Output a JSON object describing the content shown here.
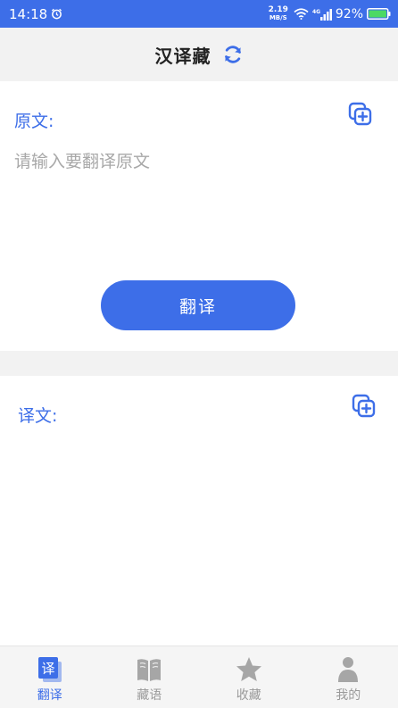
{
  "status_bar": {
    "time": "14:18",
    "net_speed_value": "2.19",
    "net_speed_unit": "MB/S",
    "network_type": "4G",
    "battery_percent": "92%"
  },
  "header": {
    "title": "汉译藏"
  },
  "source": {
    "label": "原文:",
    "placeholder": "请输入要翻译原文",
    "value": "",
    "translate_button_label": "翻译"
  },
  "result": {
    "label": "译文:",
    "text": ""
  },
  "bottom_nav": {
    "items": [
      {
        "label": "翻译",
        "icon": "translate-icon",
        "active": true
      },
      {
        "label": "藏语",
        "icon": "book-icon",
        "active": false
      },
      {
        "label": "收藏",
        "icon": "star-icon",
        "active": false
      },
      {
        "label": "我的",
        "icon": "person-icon",
        "active": false
      }
    ]
  },
  "colors": {
    "accent": "#3d6ee8",
    "header_bg": "#f2f2f2",
    "placeholder": "#a8a8a8",
    "nav_inactive": "#9a9a9a"
  }
}
